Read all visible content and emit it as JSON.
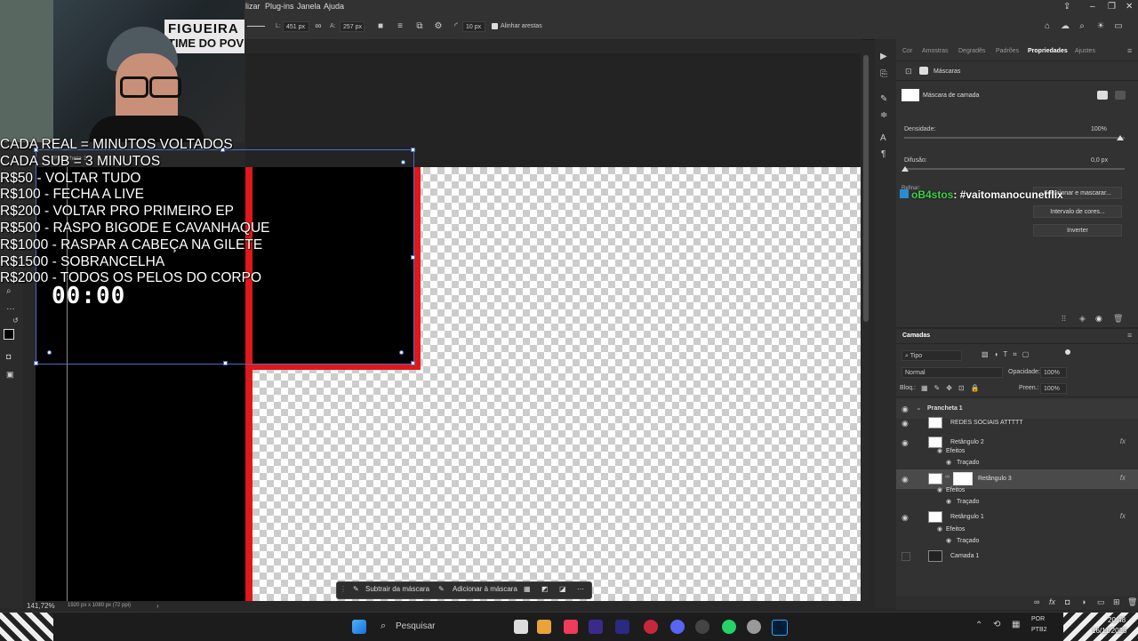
{
  "menu": {
    "items": [
      "lizar",
      "Plug-ins",
      "Janela",
      "Ajuda"
    ]
  },
  "options": {
    "l_label": "L:",
    "width": "451 px",
    "a_label": "A:",
    "height": "257 px",
    "radius": "10 px",
    "align_edges": "Alinhar arestas"
  },
  "overlay": {
    "rules": [
      "CADA REAL = MINUTOS VOLTADOS",
      "CADA SUB = 3 MINUTOS",
      "R$50 - VOLTAR TUDO",
      "R$100 - FECHA A LIVE",
      "R$200 - VOLTAR PRO PRIMEIRO EP",
      "R$500 - RASPO BIGODE E CAVANHAQUE",
      "R$1000 - RASPAR A CABEÇA NA GILETE",
      "R$1500 - SOBRANCELHA",
      "R$2000 - TODOS OS PELOS DO CORPO"
    ],
    "timer": "00:00",
    "hat_text_1": "FIGUEIRA",
    "hat_text_2": "TIME DO POV",
    "chat_user": "oB4stos",
    "chat_message": ": #vaitomanocunetflix"
  },
  "canvas": {
    "artboard_label": "Prancheta 1",
    "zoom": "141,72%",
    "doc_info": "1920 px x 1080 px (72 ppi)"
  },
  "mask_toolbar": {
    "subtract": "Subtrair da máscara",
    "add": "Adicionar à máscara"
  },
  "properties": {
    "tabs": [
      "Cor",
      "Amostras",
      "Degradês",
      "Padrões",
      "Propriedades",
      "Ajustes"
    ],
    "active_tab": "Propriedades",
    "section": "Máscaras",
    "mask_type": "Máscara de camada",
    "density_label": "Densidade:",
    "density_value": "100%",
    "feather_label": "Difusão:",
    "feather_value": "0,0 px",
    "refine_label": "Refinar:",
    "select_mask_btn": "Selecionar e mascarar...",
    "color_range_btn": "Intervalo de cores...",
    "invert_btn": "Inverter"
  },
  "layers": {
    "title": "Camadas",
    "filter_kind": "Tipo",
    "blend_mode": "Normal",
    "opacity_label": "Opacidade:",
    "opacity_value": "100%",
    "lock_label": "Bloq.:",
    "fill_label": "Preen.:",
    "fill_value": "100%",
    "group": "Prancheta 1",
    "items": [
      {
        "name": "REDES SOCIAIS ATTTTT",
        "fx": ""
      },
      {
        "name": "Retângulo 2",
        "fx": "fx"
      },
      {
        "name": "Efeitos",
        "fx": ""
      },
      {
        "name": "Traçado",
        "fx": ""
      },
      {
        "name": "Retângulo 3",
        "fx": "fx"
      },
      {
        "name": "Efeitos",
        "fx": ""
      },
      {
        "name": "Traçado",
        "fx": ""
      },
      {
        "name": "Retângulo 1",
        "fx": "fx"
      },
      {
        "name": "Efeitos",
        "fx": ""
      },
      {
        "name": "Traçado",
        "fx": ""
      },
      {
        "name": "Camada 1",
        "fx": ""
      }
    ]
  },
  "taskbar": {
    "search": "Pesquisar",
    "lang": "POR",
    "kb": "PTB2",
    "time": "20:48",
    "date": "16/11/2025"
  },
  "colors": {
    "accent_red": "#e0181b",
    "chat_green": "#3fd14a",
    "selection_blue": "#4a6fc4"
  }
}
